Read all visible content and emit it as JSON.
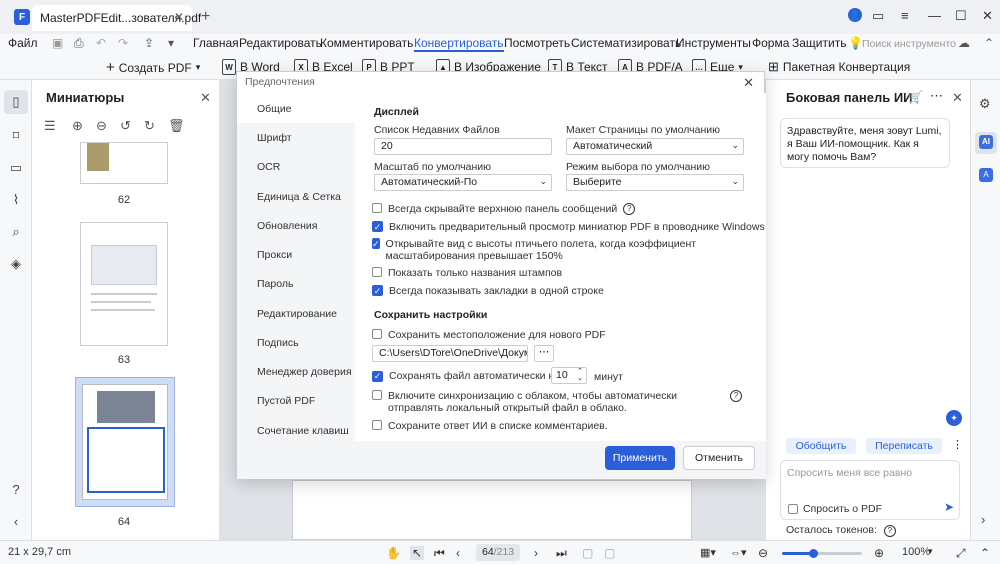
{
  "titlebar": {
    "tab_title": "MasterPDFEdit...зователя.pdf",
    "tab_close": "✕",
    "new_tab": "+",
    "app_logo": "F"
  },
  "menubar": {
    "items": [
      "Файл",
      "Главная",
      "Редактировать",
      "Комментировать",
      "Конвертировать",
      "Посмотреть",
      "Систематизировать",
      "Инструменты",
      "Форма",
      "Защитить"
    ],
    "active": "Конвертировать",
    "search_placeholder": "Поиск инструменто"
  },
  "toolbar": {
    "create_pdf": "Создать PDF",
    "to_word": "В Word",
    "to_excel": "В Excel",
    "to_ppt": "В PPT",
    "to_image": "В Изображение",
    "to_text": "В Текст",
    "to_pdfa": "В PDF/A",
    "more": "Еще",
    "batch": "Пакетная Конвертация"
  },
  "thumbnails": {
    "title": "Миниатюры",
    "pages": [
      "62",
      "63",
      "64"
    ]
  },
  "right_panel": {
    "title": "Боковая панель ИИ",
    "greeting": "Здравствуйте, меня зовут Lumi, я Ваш ИИ-помощник. Как я могу помочь Вам?",
    "summarize": "Обобщить",
    "rewrite": "Переписать",
    "input_placeholder": "Спросить меня все равно",
    "ask_pdf": "Спросить о PDF",
    "tokens": "Осталось токенов:"
  },
  "statusbar": {
    "page_size": "21 x 29,7 cm",
    "current_page": "64",
    "total_pages": "/213",
    "zoom": "100%"
  },
  "dialog": {
    "title": "Предпочтения",
    "nav": [
      "Общие",
      "Шрифт",
      "OCR",
      "Единица & Сетка",
      "Обновления",
      "Прокси",
      "Пароль",
      "Редактирование",
      "Подпись",
      "Менеджер доверия",
      "Пустой PDF",
      "Сочетание клавиш"
    ],
    "display_title": "Дисплей",
    "recent_label": "Список Недавних Файлов",
    "recent_value": "20",
    "layout_label": "Макет Страницы по умолчанию",
    "layout_value": "Автоматический",
    "zoom_label": "Масштаб по умолчанию",
    "zoom_value": "Автоматический-По",
    "select_mode_label": "Режим выбора по умолчанию",
    "select_mode_value": "Выберите",
    "opt_hide_msgbar": "Всегда скрывайте верхнюю панель сообщений",
    "opt_preview": "Включить предварительный просмотр миниатюр PDF в проводнике Windows",
    "opt_birdview": "Открывайте вид с высоты птичьего полета, когда коэффициент масштабирования превышает 150%",
    "opt_stamps": "Показать только названия штампов",
    "opt_bookmarks": "Всегда показывать закладки в одной строке",
    "save_title": "Сохранить настройки",
    "opt_save_location": "Сохранить местоположение для нового PDF",
    "path_value": "C:\\Users\\DTore\\OneDrive\\Документы",
    "opt_autosave": "Сохранять файл автоматически каждые",
    "autosave_value": "10",
    "autosave_unit": "минут",
    "opt_cloud": "Включите синхронизацию с облаком, чтобы автоматически отправлять локальный открытый файл в облако.",
    "opt_ai_answer": "Сохраните ответ ИИ в списке комментариев.",
    "apply": "Применить",
    "cancel": "Отменить"
  }
}
